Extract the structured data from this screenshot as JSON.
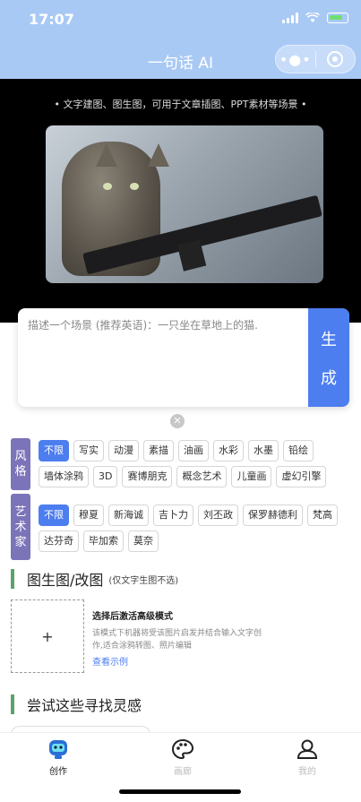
{
  "status": {
    "time": "17:07"
  },
  "nav": {
    "title": "一句话 AI",
    "more_icon": "more-dots-icon",
    "close_icon": "target-close-icon"
  },
  "hero": {
    "caption": "• 文字建图、图生图，可用于文章插图、PPT素材等场景 •",
    "slide_count": 3,
    "active_slide": 1
  },
  "prompt": {
    "placeholder": "描述一个场景 (推荐英语)：一只坐在草地上的猫.",
    "button_chars": [
      "生",
      "成"
    ]
  },
  "styles": {
    "label": [
      "风",
      "格"
    ],
    "tags": [
      "不限",
      "写实",
      "动漫",
      "素描",
      "油画",
      "水彩",
      "水墨",
      "铅绘",
      "墙体涂鸦",
      "3D",
      "赛博朋克",
      "概念艺术",
      "儿童画",
      "虚幻引擎"
    ],
    "active": 0
  },
  "artists": {
    "label": [
      "艺",
      "术",
      "家"
    ],
    "tags": [
      "不限",
      "穆夏",
      "新海诚",
      "吉卜力",
      "刘丕政",
      "保罗赫德利",
      "梵高",
      "达芬奇",
      "毕加索",
      "莫奈"
    ],
    "active": 0
  },
  "img2img": {
    "title": "图生图/改图",
    "subtitle": "(仅文字生图不选)",
    "upload_symbol": "+",
    "hint_title": "选择后激活高级模式",
    "hint_desc": "该模式下机器将受该图片启发并结合输入文字创作,适合涂鸦转图、照片编辑",
    "example_link": "查看示例"
  },
  "inspiration": {
    "title": "尝试这些寻找灵感"
  },
  "tabs": [
    {
      "label": "创作",
      "icon": "robot-icon",
      "active": true
    },
    {
      "label": "画廊",
      "icon": "palette-icon",
      "active": false
    },
    {
      "label": "我的",
      "icon": "user-icon",
      "active": false
    }
  ],
  "colors": {
    "accent": "#4d7ef0",
    "header": "#a9c9f5",
    "label_bg": "#7c74b8",
    "section_bar": "#5aa46a"
  }
}
